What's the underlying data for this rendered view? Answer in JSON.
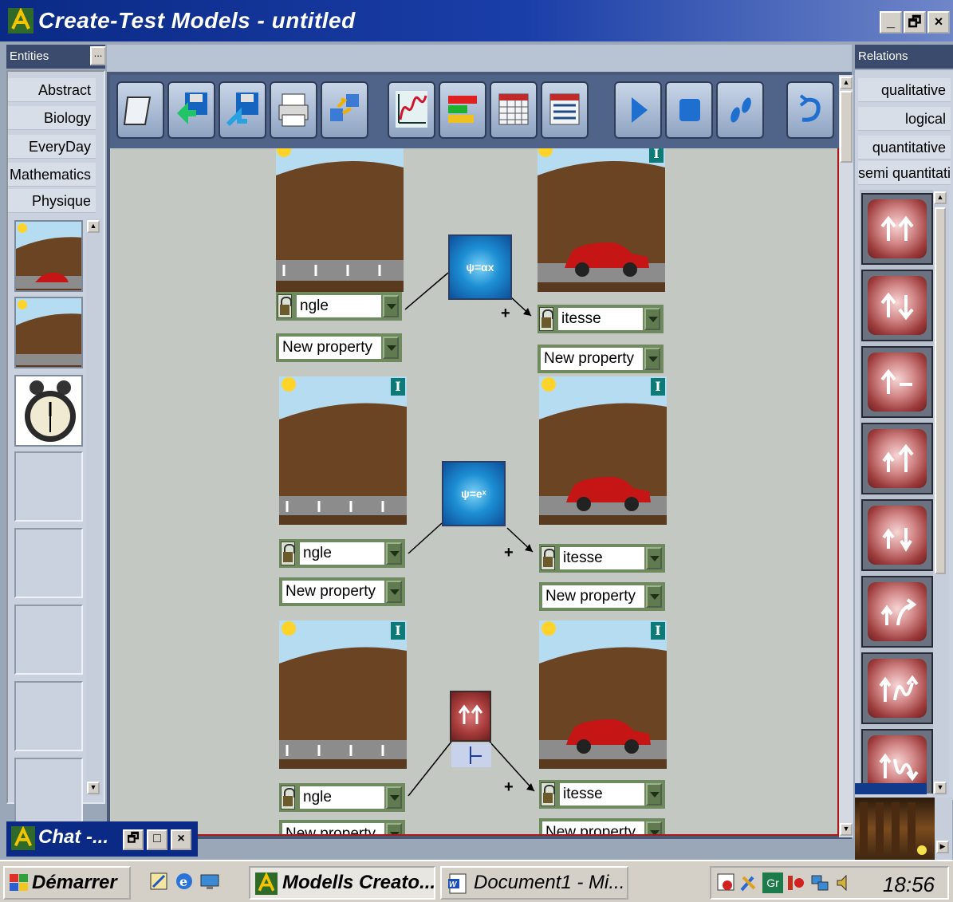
{
  "window": {
    "title": "Create-Test Models - untitled",
    "min": "_",
    "restore": "🗗",
    "close": "×"
  },
  "entities": {
    "header": "Entities",
    "more": "...",
    "categories": [
      "Abstract",
      "Biology",
      "EveryDay",
      "Mathematics",
      "Physique"
    ]
  },
  "relations": {
    "header": "Relations",
    "categories": [
      "qualitative",
      "logical",
      "quantitative",
      "semi quantitativ"
    ]
  },
  "toolbar": {
    "buttons": [
      "new-document",
      "save",
      "save-as",
      "print",
      "export",
      "graph",
      "bar-chart",
      "table",
      "list",
      "play",
      "stop",
      "step",
      "undo"
    ]
  },
  "model": {
    "rows": [
      {
        "left_property": "ngle",
        "right_property": "itesse",
        "new_property": "New property",
        "function": "ψ=αx",
        "sign": "+",
        "badge": "I"
      },
      {
        "left_property": "ngle",
        "right_property": "itesse",
        "new_property": "New property",
        "function": "ψ=eˣ",
        "sign": "+",
        "badge": "I"
      },
      {
        "left_property": "ngle",
        "right_property": "itesse",
        "new_property": "New property",
        "function": "",
        "sign": "+",
        "badge": "I"
      }
    ]
  },
  "chat": {
    "title": "Chat -..."
  },
  "taskbar": {
    "start": "Démarrer",
    "tasks": [
      "Modells Creato...",
      "Document1 - Mi..."
    ],
    "tray_label": "Gr",
    "clock": "18:56"
  },
  "colors": {
    "titlebar": "#0b2a86",
    "workspace": "#c3c9c2",
    "relation": "#a83c3c",
    "badge": "#0e7a77"
  }
}
